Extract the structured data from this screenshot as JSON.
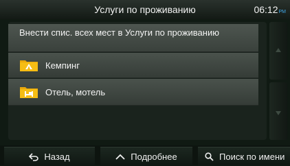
{
  "header": {
    "title": "Услуги по проживанию",
    "time": "06:12",
    "time_suffix": "PM"
  },
  "list": {
    "action_item": "Внести спис. всех мест в Услуги по проживанию",
    "items": [
      {
        "label": "Кемпинг",
        "icon": "camping-folder-icon"
      },
      {
        "label": "Отель, мотель",
        "icon": "hotel-folder-icon"
      }
    ]
  },
  "scroll": {
    "up_icon": "scroll-up-icon",
    "down_icon": "scroll-down-icon"
  },
  "bottom_bar": {
    "back_label": "Назад",
    "more_label": "Подробнее",
    "search_label": "Поиск по имени"
  },
  "colors": {
    "folder": "#f2b80f",
    "accent": "#3fa7e8",
    "list_item": "#454d47"
  }
}
